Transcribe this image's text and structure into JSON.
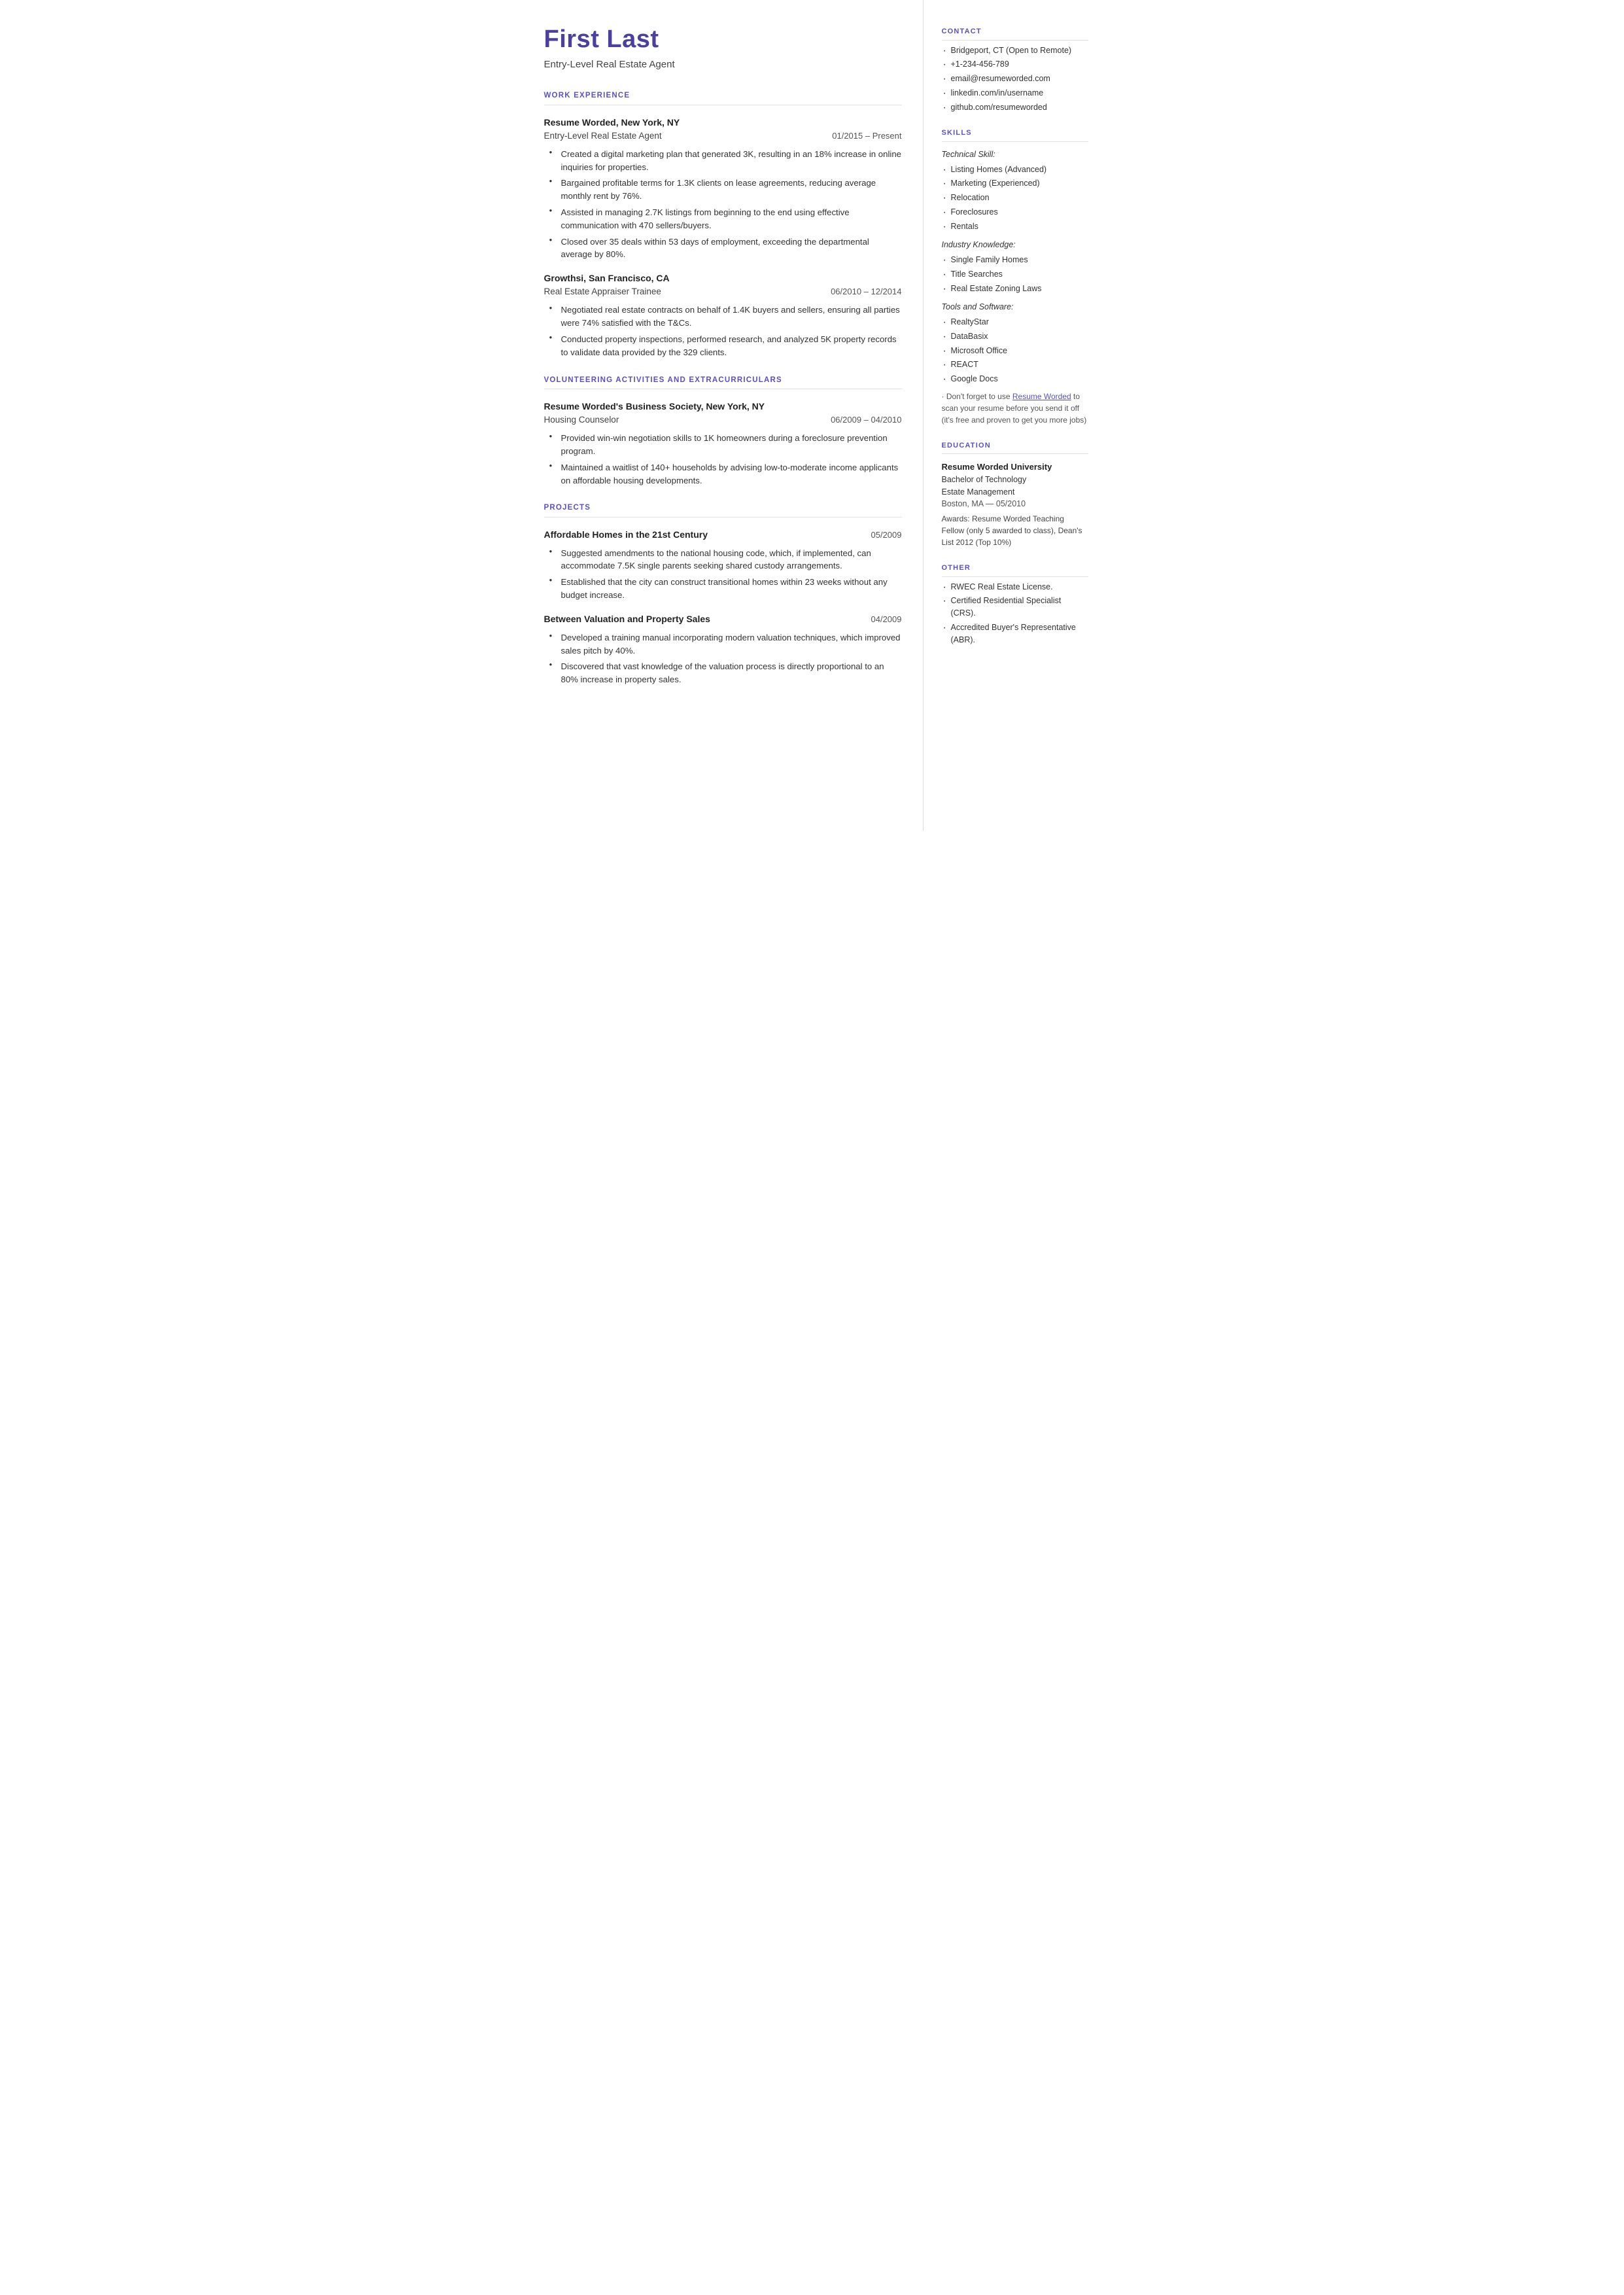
{
  "header": {
    "name": "First Last",
    "subtitle": "Entry-Level Real Estate Agent"
  },
  "sections": {
    "work_experience_title": "WORK EXPERIENCE",
    "volunteering_title": "VOLUNTEERING ACTIVITIES AND EXTRACURRICULARS",
    "projects_title": "PROJECTS"
  },
  "jobs": [
    {
      "company": "Resume Worded, New York, NY",
      "title": "Entry-Level Real Estate Agent",
      "dates": "01/2015 – Present",
      "bullets": [
        "Created a digital marketing plan that generated 3K, resulting in an 18% increase in online inquiries for properties.",
        "Bargained profitable terms for 1.3K clients on lease agreements, reducing average monthly rent by 76%.",
        "Assisted in managing 2.7K listings from beginning to the end using effective communication with 470 sellers/buyers.",
        "Closed over 35 deals within 53 days of employment, exceeding the departmental average by 80%."
      ]
    },
    {
      "company": "Growthsi, San Francisco, CA",
      "title": "Real Estate Appraiser Trainee",
      "dates": "06/2010 – 12/2014",
      "bullets": [
        "Negotiated real estate contracts on behalf of 1.4K buyers and sellers, ensuring all parties were 74% satisfied with the T&Cs.",
        "Conducted property inspections, performed research, and analyzed 5K property records to validate data provided by the 329 clients."
      ]
    }
  ],
  "volunteering": [
    {
      "company": "Resume Worded's Business Society, New York, NY",
      "title": "Housing Counselor",
      "dates": "06/2009 – 04/2010",
      "bullets": [
        "Provided win-win negotiation skills to 1K homeowners during a foreclosure prevention program.",
        "Maintained a waitlist of 140+ households by advising low-to-moderate income applicants on affordable housing developments."
      ]
    }
  ],
  "projects": [
    {
      "title": "Affordable Homes in the 21st Century",
      "date": "05/2009",
      "bullets": [
        "Suggested amendments to the national housing code, which, if implemented, can accommodate 7.5K single parents seeking shared custody arrangements.",
        "Established that the city can construct transitional homes within 23 weeks without any budget increase."
      ]
    },
    {
      "title": "Between Valuation and Property Sales",
      "date": "04/2009",
      "bullets": [
        "Developed a training manual incorporating modern valuation techniques, which improved sales pitch by 40%.",
        "Discovered that vast knowledge of the valuation process is directly proportional to an 80% increase in property sales."
      ]
    }
  ],
  "contact": {
    "title": "CONTACT",
    "items": [
      "Bridgeport, CT (Open to Remote)",
      "+1-234-456-789",
      "email@resumeworded.com",
      "linkedin.com/in/username",
      "github.com/resumeworded"
    ]
  },
  "skills": {
    "title": "SKILLS",
    "technical_label": "Technical Skill:",
    "technical": [
      "Listing Homes (Advanced)",
      "Marketing (Experienced)",
      "Relocation",
      "Foreclosures",
      "Rentals"
    ],
    "industry_label": "Industry Knowledge:",
    "industry": [
      "Single Family Homes",
      "Title Searches",
      "Real Estate Zoning Laws"
    ],
    "tools_label": "Tools and Software:",
    "tools": [
      "RealtyStar",
      "DataBasix",
      "Microsoft Office",
      "REACT",
      "Google Docs"
    ],
    "promo": "Don't forget to use Resume Worded to scan your resume before you send it off (it's free and proven to get you more jobs)"
  },
  "education": {
    "title": "EDUCATION",
    "school": "Resume Worded University",
    "degree": "Bachelor of Technology",
    "field": "Estate Management",
    "location": "Boston, MA — 05/2010",
    "awards": "Awards: Resume Worded Teaching Fellow (only 5 awarded to class), Dean's List 2012 (Top 10%)"
  },
  "other": {
    "title": "OTHER",
    "items": [
      "RWEC Real Estate License.",
      "Certified Residential Specialist (CRS).",
      "Accredited Buyer's Representative (ABR)."
    ]
  }
}
